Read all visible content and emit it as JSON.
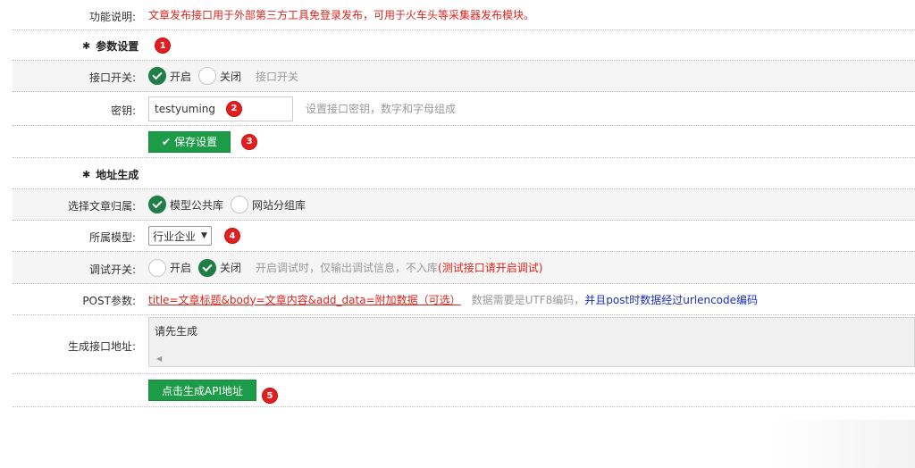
{
  "func": {
    "label": "功能说明:",
    "desc": "文章发布接口用于外部第三方工具免登录发布，可用于火车头等采集器发布模块。"
  },
  "section_params": {
    "title": "参数设置",
    "badge": "1"
  },
  "interface_switch": {
    "label": "接口开关:",
    "opt_on": "开启",
    "opt_off": "关闭",
    "hint": "接口开关",
    "selected": "开启"
  },
  "secret": {
    "label": "密钥:",
    "value": "testyuming",
    "badge": "2",
    "hint": "设置接口密钥，数字和字母组成"
  },
  "save": {
    "label": "保存设置",
    "badge": "3"
  },
  "section_addr": {
    "title": "地址生成"
  },
  "belong": {
    "label": "选择文章归属:",
    "opt_a": "模型公共库",
    "opt_b": "网站分组库",
    "selected": "模型公共库"
  },
  "model": {
    "label": "所属模型:",
    "value": "行业企业",
    "badge": "4"
  },
  "debug": {
    "label": "调试开关:",
    "opt_on": "开启",
    "opt_off": "关闭",
    "selected": "关闭",
    "hint": "开启调试时，仅输出调试信息，不入库",
    "hint_red": "(测试接口请开启调试)"
  },
  "post": {
    "label": "POST参数:",
    "params": "title=文章标题&body=文章内容&add_data=附加数据（可选）",
    "note_gray": "数据需要是UTF8编码，",
    "note_blue": "并且post时数据经过urlencode编码"
  },
  "gen_addr": {
    "label": "生成接口地址:",
    "value": "请先生成"
  },
  "gen_button": {
    "label": "点击生成API地址",
    "badge": "5"
  },
  "colors": {
    "accent_green": "#1d9c48",
    "badge_red": "#e02020",
    "link_blue": "#1a2fbf",
    "text_red": "#d9241c"
  }
}
